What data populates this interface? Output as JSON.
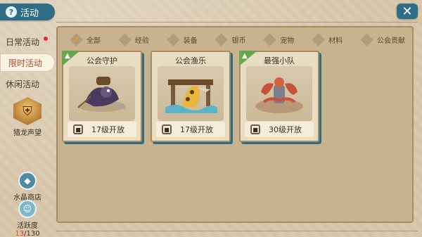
{
  "title": "活动",
  "close_icon": "close-icon",
  "sidebar": {
    "items": [
      {
        "label": "日常活动",
        "has_dot": true
      },
      {
        "label": "限时活动",
        "active": true
      },
      {
        "label": "休闲活动"
      }
    ],
    "hunter_prestige": "猎龙声望",
    "crystal_shop": "水晶商店",
    "activity": {
      "label": "活跃度",
      "current": "13",
      "total": "/130"
    }
  },
  "filters": [
    {
      "label": "全部",
      "checked": true
    },
    {
      "label": "经验"
    },
    {
      "label": "装备"
    },
    {
      "label": "银币"
    },
    {
      "label": "宠物"
    },
    {
      "label": "材料"
    },
    {
      "label": "公会贡献"
    }
  ],
  "cards": [
    {
      "name": "公会守护",
      "unlock": "17级开放",
      "has_corner": true
    },
    {
      "name": "公会渔乐",
      "unlock": "17级开放",
      "has_corner": false
    },
    {
      "name": "最强小队",
      "unlock": "30级开放",
      "has_corner": true
    }
  ]
}
